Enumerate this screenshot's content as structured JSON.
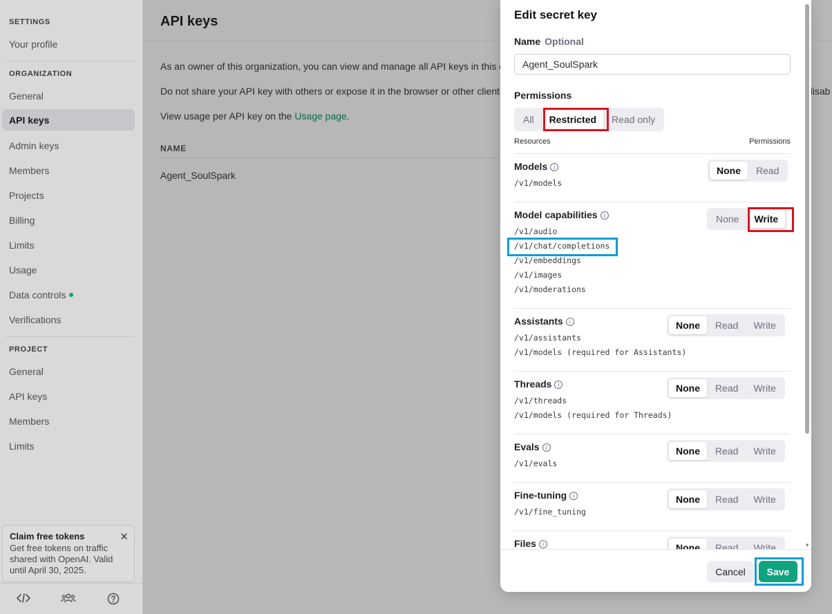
{
  "sidebar": {
    "settings_header": "SETTINGS",
    "your_profile": "Your profile",
    "organization_header": "ORGANIZATION",
    "org_items": [
      "General",
      "API keys",
      "Admin keys",
      "Members",
      "Projects",
      "Billing",
      "Limits",
      "Usage",
      "Data controls",
      "Verifications"
    ],
    "project_header": "PROJECT",
    "project_items": [
      "General",
      "API keys",
      "Members",
      "Limits"
    ],
    "promo": {
      "title": "Claim free tokens",
      "text": "Get free tokens on traffic shared with OpenAI. Valid until April 30, 2025.",
      "close": "✕"
    },
    "footer_icons": [
      "code-icon",
      "team-icon",
      "help-icon"
    ]
  },
  "main": {
    "title": "API keys",
    "line1": "As an owner of this organization, you can view and manage all API keys in this or",
    "line2": "Do not share your API key with others or expose it in the browser or other client-",
    "line2_right": "disab",
    "line3_prefix": "View usage per API key on the ",
    "line3_link": "Usage page",
    "line3_suffix": ".",
    "col_name": "NAME",
    "row_name": "Agent_SoulSpark"
  },
  "modal": {
    "title": "Edit secret key",
    "name_label": "Name",
    "name_optional": "Optional",
    "name_value": "Agent_SoulSpark",
    "permissions_label": "Permissions",
    "perm_options": [
      "All",
      "Restricted",
      "Read only"
    ],
    "perm_selected": "Restricted",
    "resources_head": "Resources",
    "permissions_head": "Permissions",
    "resources": [
      {
        "name": "Models",
        "paths": [
          "/v1/models"
        ],
        "options": [
          "None",
          "Read"
        ],
        "selected": "None"
      },
      {
        "name": "Model capabilities",
        "paths": [
          "/v1/audio",
          "/v1/chat/completions",
          "/v1/embeddings",
          "/v1/images",
          "/v1/moderations"
        ],
        "options": [
          "None",
          "Write"
        ],
        "selected": "Write"
      },
      {
        "name": "Assistants",
        "paths": [
          "/v1/assistants",
          "/v1/models (required for Assistants)"
        ],
        "options": [
          "None",
          "Read",
          "Write"
        ],
        "selected": "None"
      },
      {
        "name": "Threads",
        "paths": [
          "/v1/threads",
          "/v1/models (required for Threads)"
        ],
        "options": [
          "None",
          "Read",
          "Write"
        ],
        "selected": "None"
      },
      {
        "name": "Evals",
        "paths": [
          "/v1/evals"
        ],
        "options": [
          "None",
          "Read",
          "Write"
        ],
        "selected": "None"
      },
      {
        "name": "Fine-tuning",
        "paths": [
          "/v1/fine_tuning"
        ],
        "options": [
          "None",
          "Read",
          "Write"
        ],
        "selected": "None"
      },
      {
        "name": "Files",
        "paths": [],
        "options": [
          "None",
          "Read",
          "Write"
        ],
        "selected": "None"
      }
    ],
    "cancel": "Cancel",
    "save": "Save",
    "info_glyph": "i"
  },
  "colors": {
    "accent_green": "#10a37f",
    "highlight_red": "#d9141e",
    "highlight_blue": "#0f9bd7"
  }
}
